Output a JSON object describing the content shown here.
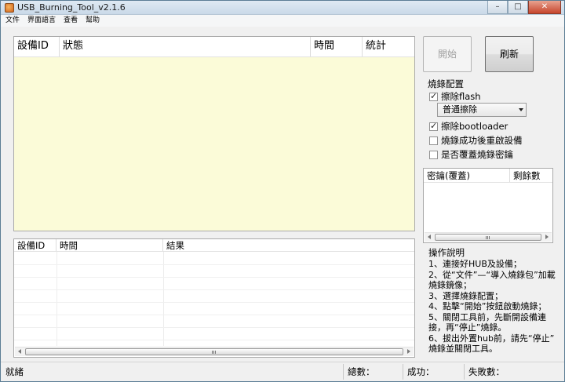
{
  "window": {
    "title": "USB_Burning_Tool_v2.1.6",
    "min": "–",
    "max": "□",
    "close": "✕"
  },
  "menu": [
    "文件",
    "界面語言",
    "查看",
    "幫助"
  ],
  "device_table": {
    "columns": [
      "設備ID",
      "狀態",
      "時間",
      "統計"
    ],
    "bg": "#fbfbd8"
  },
  "buttons": {
    "start": "開始",
    "refresh": "刷新"
  },
  "config": {
    "title": "燒錄配置",
    "erase_flash": {
      "label": "擦除flash",
      "checked": true
    },
    "erase_mode": "普通擦除",
    "erase_bootloader": {
      "label": "擦除bootloader",
      "checked": true
    },
    "reboot_after": {
      "label": "燒錄成功後重啟設備",
      "checked": false
    },
    "overwrite_key": {
      "label": "是否覆蓋燒錄密鑰",
      "checked": false
    }
  },
  "key_table": {
    "columns": [
      "密鑰(覆蓋)",
      "剩餘數"
    ]
  },
  "log_table": {
    "columns": [
      "設備ID",
      "時間",
      "結果"
    ]
  },
  "instructions": {
    "title": "操作說明",
    "lines": [
      "1、連接好HUB及設備；",
      "2、從“文件”—“導入燒錄包”加載",
      "燒錄鏡像；",
      "3、選擇燒錄配置；",
      "4、點擊“開始”按鈕啟動燒錄；",
      "5、關閉工具前，先斷開設備連",
      "接，再“停止”燒錄。",
      "6、拔出外置hub前，請先“停止”",
      "燒錄並關閉工具。"
    ]
  },
  "status": {
    "ready": "就緒",
    "total": "總數：",
    "success": "成功：",
    "fail": "失敗數："
  }
}
